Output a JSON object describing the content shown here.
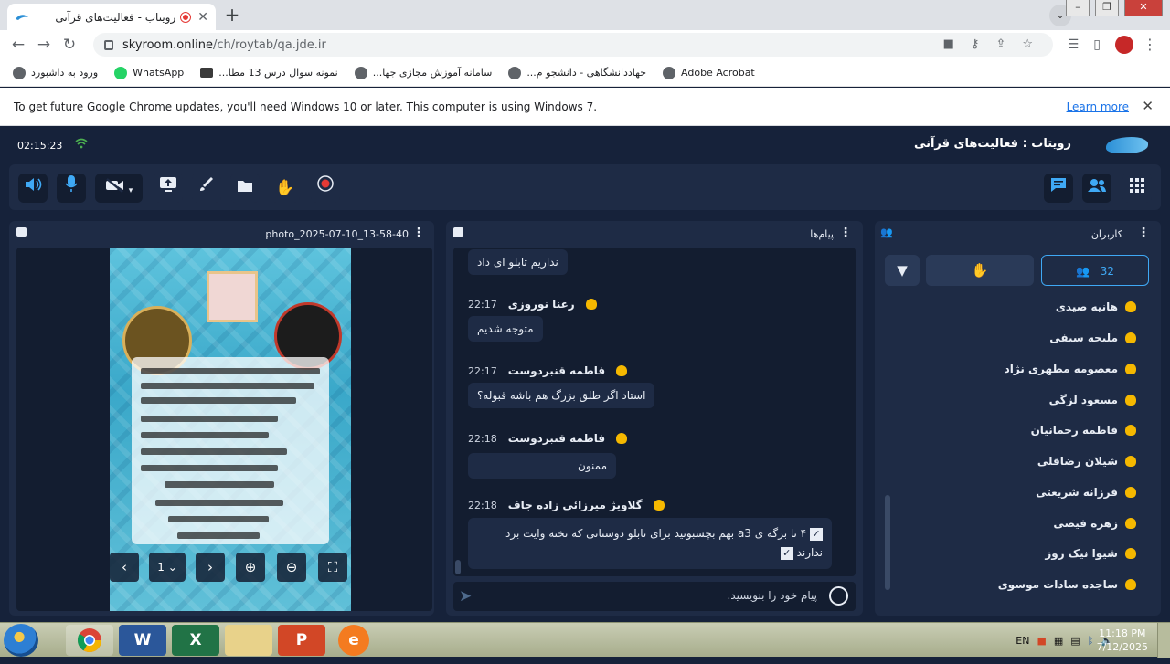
{
  "browser": {
    "tab_title": "رویتاب - فعالیت‌های قرآنی",
    "url_domain": "skyroom.online",
    "url_path": "/ch/roytab/qa.jde.ir",
    "bookmarks": [
      {
        "label": "ورود به داشبورد",
        "icon": "globe-icon"
      },
      {
        "label": "WhatsApp",
        "icon": "whatsapp-icon"
      },
      {
        "label": "نمونه سوال درس 13 مطا...",
        "icon": "folder-icon"
      },
      {
        "label": "سامانه آموزش مجازی جها...",
        "icon": "globe-icon"
      },
      {
        "label": "جهاددانشگاهی - دانشجو م...",
        "icon": "globe-icon"
      },
      {
        "label": "Adobe Acrobat",
        "icon": "globe-icon"
      }
    ],
    "infobar_text": "To get future Google Chrome updates, you'll need Windows 10 or later. This computer is using Windows 7.",
    "infobar_link": "Learn more"
  },
  "app": {
    "clock": "02:15:23",
    "room_title": "رویتاب : فعالیت‌های قرآنی",
    "accent": "#3fa9f5",
    "bg": "#16223a",
    "panel_bg": "#1e2b45"
  },
  "viewer": {
    "title": "photo_2025-07-10_13-58-40",
    "page": "1"
  },
  "chat": {
    "title": "پیام‌ها",
    "input_placeholder": "پیام خود را بنویسید.",
    "messages": [
      {
        "text": "نداریم تابلو ای داد"
      },
      {
        "name": "رعنا نوروزی",
        "time": "22:17",
        "text": "متوجه شدیم"
      },
      {
        "name": "فاطمه قنبردوست",
        "time": "22:17",
        "text": "استاد اگر طلق بزرگ هم باشه قبوله؟"
      },
      {
        "name": "فاطمه قنبردوست",
        "time": "22:18",
        "text": "ممنون"
      },
      {
        "name": "گلاویژ میرزائی زاده جاف",
        "time": "22:18",
        "text_line1": "۴ تا برگه ی a3 بهم بچسبونید برای تابلو دوستانی که تخته وایت برد",
        "text_line2": "ندارند"
      }
    ]
  },
  "users": {
    "title": "کاربران",
    "count": "32",
    "list": [
      "هانیه صیدی",
      "ملیحه سیفی",
      "معصومه مطهری نژاد",
      "مسعود لزگی",
      "فاطمه رحمانیان",
      "شیلان رضاقلی",
      "فرزانه شریعتی",
      "زهره فیضی",
      "شیوا نیک روز",
      "ساجده سادات موسوی"
    ]
  },
  "taskbar": {
    "lang": "EN",
    "time": "11:18 PM",
    "date": "7/12/2025"
  }
}
